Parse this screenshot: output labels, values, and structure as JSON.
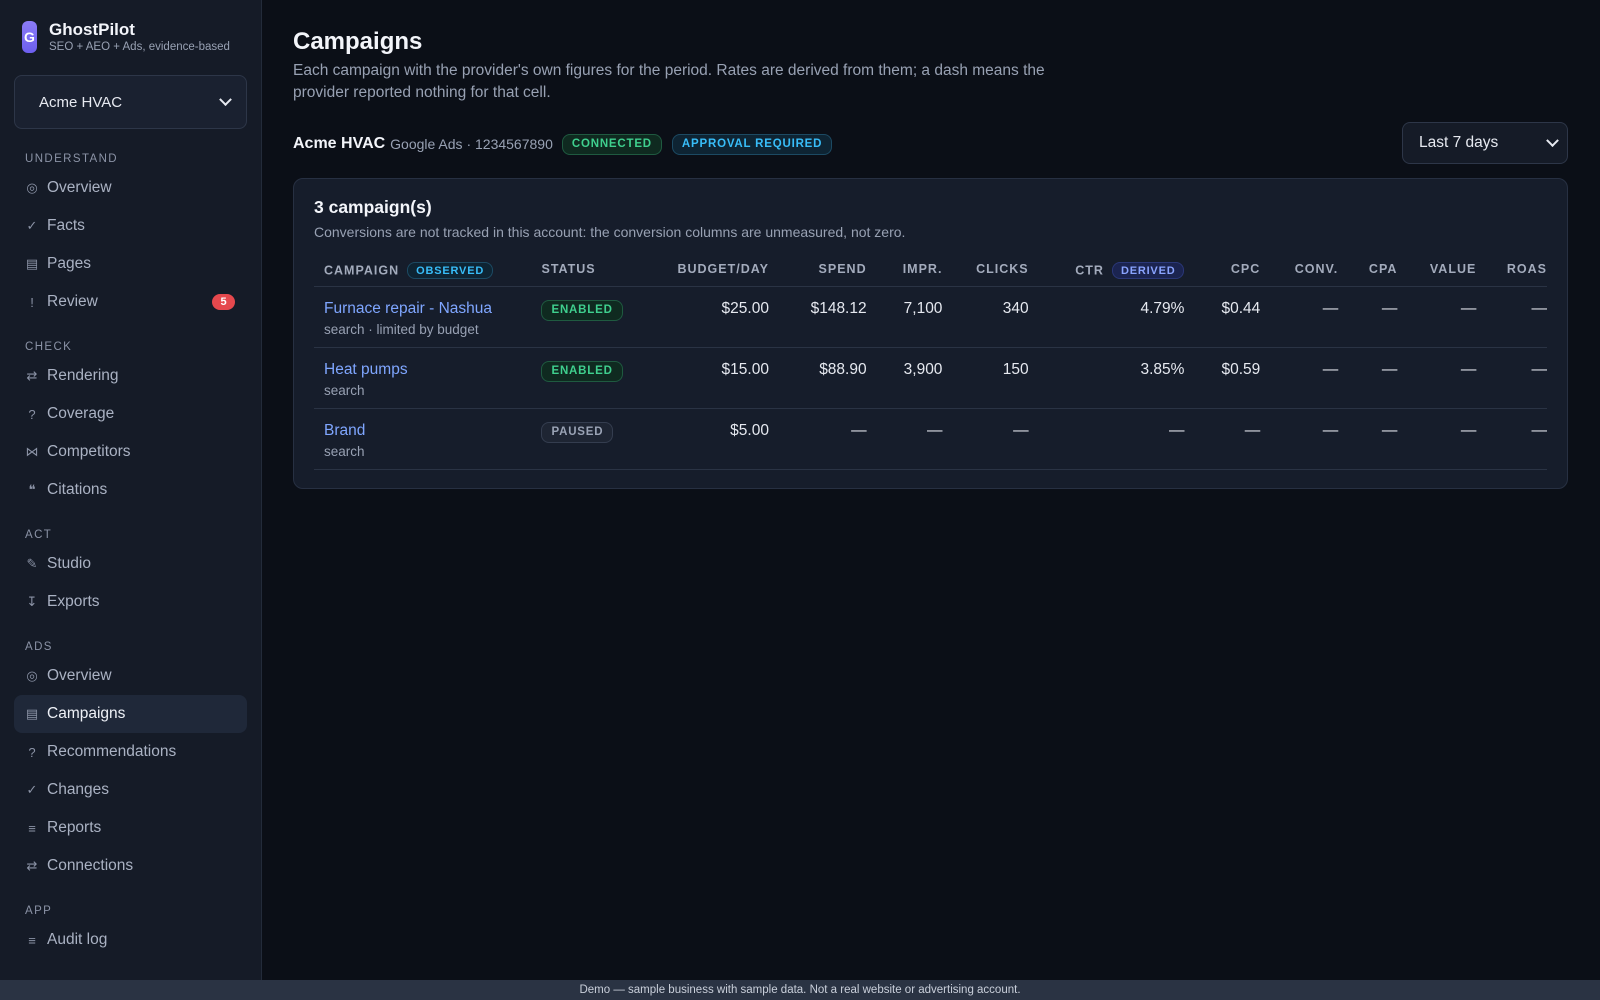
{
  "brand": {
    "logo_letter": "G",
    "name": "GhostPilot",
    "tagline": "SEO + AEO + Ads, evidence-based"
  },
  "account_selector": {
    "value": "Acme HVAC"
  },
  "sidebar": {
    "sections": [
      {
        "label": "UNDERSTAND",
        "items": [
          {
            "icon": "◎",
            "icon_name": "target-icon",
            "label": "Overview"
          },
          {
            "icon": "✓",
            "icon_name": "check-icon",
            "label": "Facts"
          },
          {
            "icon": "▤",
            "icon_name": "pages-icon",
            "label": "Pages"
          },
          {
            "icon": "!",
            "icon_name": "alert-icon",
            "label": "Review",
            "badge": "5"
          }
        ]
      },
      {
        "label": "CHECK",
        "items": [
          {
            "icon": "⇄",
            "icon_name": "swap-icon",
            "label": "Rendering"
          },
          {
            "icon": "?",
            "icon_name": "question-icon",
            "label": "Coverage"
          },
          {
            "icon": "⋈",
            "icon_name": "bowtie-icon",
            "label": "Competitors"
          },
          {
            "icon": "❝",
            "icon_name": "quote-icon",
            "label": "Citations"
          }
        ]
      },
      {
        "label": "ACT",
        "items": [
          {
            "icon": "✎",
            "icon_name": "pencil-icon",
            "label": "Studio"
          },
          {
            "icon": "↧",
            "icon_name": "download-icon",
            "label": "Exports"
          }
        ]
      },
      {
        "label": "ADS",
        "items": [
          {
            "icon": "◎",
            "icon_name": "target-icon",
            "label": "Overview"
          },
          {
            "icon": "▤",
            "icon_name": "table-icon",
            "label": "Campaigns",
            "active": true
          },
          {
            "icon": "?",
            "icon_name": "question-icon",
            "label": "Recommendations"
          },
          {
            "icon": "✓",
            "icon_name": "check-icon",
            "label": "Changes"
          },
          {
            "icon": "≡",
            "icon_name": "list-icon",
            "label": "Reports"
          },
          {
            "icon": "⇄",
            "icon_name": "swap-icon",
            "label": "Connections"
          }
        ]
      },
      {
        "label": "APP",
        "items": [
          {
            "icon": "≡",
            "icon_name": "list-icon",
            "label": "Audit log"
          }
        ]
      }
    ]
  },
  "page": {
    "title": "Campaigns",
    "description": "Each campaign with the provider's own figures for the period. Rates are derived from them; a dash means the provider reported nothing for that cell."
  },
  "account_bar": {
    "name": "Acme HVAC",
    "meta": "Google Ads · 1234567890",
    "status_connected": "CONNECTED",
    "status_approval": "APPROVAL REQUIRED",
    "date_range": "Last 7 days"
  },
  "card": {
    "title": "3 campaign(s)",
    "subtitle": "Conversions are not tracked in this account: the conversion columns are unmeasured, not zero."
  },
  "table": {
    "headers": {
      "campaign": "CAMPAIGN",
      "campaign_tag": "OBSERVED",
      "status": "STATUS",
      "budget": "BUDGET/DAY",
      "spend": "SPEND",
      "impr": "IMPR.",
      "clicks": "CLICKS",
      "ctr": "CTR",
      "ctr_tag": "DERIVED",
      "cpc": "CPC",
      "conv": "CONV.",
      "cpa": "CPA",
      "value": "VALUE",
      "roas": "ROAS"
    },
    "rows": [
      {
        "name": "Furnace repair - Nashua",
        "sub": "search · limited by budget",
        "status": "ENABLED",
        "budget": "$25.00",
        "spend": "$148.12",
        "impr": "7,100",
        "clicks": "340",
        "ctr": "4.79%",
        "cpc": "$0.44",
        "conv": "—",
        "cpa": "—",
        "value": "—",
        "roas": "—"
      },
      {
        "name": "Heat pumps",
        "sub": "search",
        "status": "ENABLED",
        "budget": "$15.00",
        "spend": "$88.90",
        "impr": "3,900",
        "clicks": "150",
        "ctr": "3.85%",
        "cpc": "$0.59",
        "conv": "—",
        "cpa": "—",
        "value": "—",
        "roas": "—"
      },
      {
        "name": "Brand",
        "sub": "search",
        "status": "PAUSED",
        "budget": "$5.00",
        "spend": "—",
        "impr": "—",
        "clicks": "—",
        "ctr": "—",
        "cpc": "—",
        "conv": "—",
        "cpa": "—",
        "value": "—",
        "roas": "—"
      }
    ]
  },
  "footer": {
    "text": "Demo — sample business with sample data. Not a real website or advertising account."
  }
}
